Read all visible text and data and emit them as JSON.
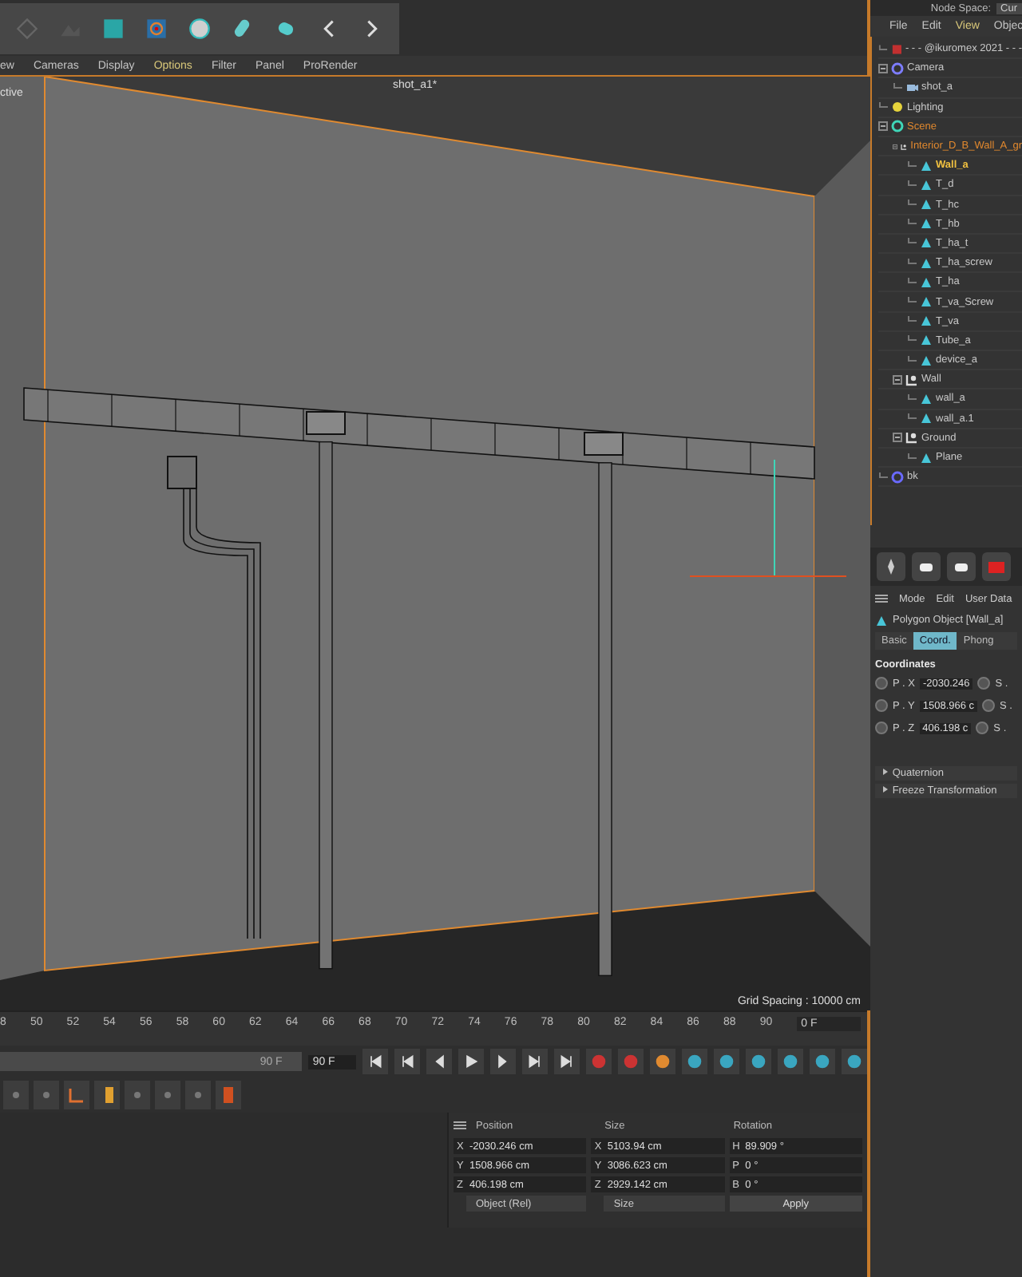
{
  "toolbar_menu": [
    {
      "label": "ew",
      "selected": false
    },
    {
      "label": "Cameras",
      "selected": false
    },
    {
      "label": "Display",
      "selected": false
    },
    {
      "label": "Options",
      "selected": true
    },
    {
      "label": "Filter",
      "selected": false
    },
    {
      "label": "Panel",
      "selected": false
    },
    {
      "label": "ProRender",
      "selected": false
    }
  ],
  "viewport": {
    "camera": "ctive",
    "title": "shot_a1*",
    "grid_spacing": "Grid Spacing : 10000 cm"
  },
  "timeline": {
    "ticks": [
      "8",
      "50",
      "52",
      "54",
      "56",
      "58",
      "60",
      "62",
      "64",
      "66",
      "68",
      "70",
      "72",
      "74",
      "76",
      "78",
      "80",
      "82",
      "84",
      "86",
      "88",
      "90"
    ],
    "current_frame": "0 F",
    "range_end": "90 F",
    "level": 1,
    "max_frame": "90 F"
  },
  "coordinate_manager": {
    "columns": [
      "Position",
      "Size",
      "Rotation"
    ],
    "rows": [
      {
        "axis": "X",
        "position": "-2030.246 cm",
        "size_axis": "X",
        "size": "5103.94 cm",
        "rotation_axis": "H",
        "rotation": "89.909 °"
      },
      {
        "axis": "Y",
        "position": "1508.966 cm",
        "size_axis": "Y",
        "size": "3086.623 cm",
        "rotation_axis": "P",
        "rotation": "0 °"
      },
      {
        "axis": "Z",
        "position": "406.198 cm",
        "size_axis": "Z",
        "size": "2929.142 cm",
        "rotation_axis": "B",
        "rotation": "0 °"
      }
    ],
    "position_mode": "Object (Rel)",
    "size_mode": "Size",
    "apply": "Apply"
  },
  "node_space": {
    "label": "Node Space:",
    "value": "Cur"
  },
  "object_manager": {
    "menu": [
      {
        "label": "File",
        "selected": false
      },
      {
        "label": "Edit",
        "selected": false
      },
      {
        "label": "View",
        "selected": true
      },
      {
        "label": "Objec",
        "selected": false
      }
    ],
    "tree": [
      {
        "label": "- - - @ikuromex 2021 - - -",
        "kind": "marker",
        "selected": false,
        "highlighted": false
      },
      {
        "label": "Camera",
        "kind": "null",
        "selected": false,
        "highlighted": false,
        "children": [
          {
            "label": "shot_a",
            "kind": "camera",
            "selected": false,
            "highlighted": false
          }
        ]
      },
      {
        "label": "Lighting",
        "kind": "light",
        "selected": false,
        "highlighted": false
      },
      {
        "label": "Scene",
        "kind": "scene",
        "selected": false,
        "highlighted": true,
        "children": [
          {
            "label": "Interior_D_B_Wall_A_gr",
            "kind": "group",
            "selected": false,
            "highlighted": true,
            "children": [
              {
                "label": "Wall_a",
                "kind": "polygon",
                "selected": true,
                "highlighted": false
              },
              {
                "label": "T_d",
                "kind": "polygon",
                "selected": false,
                "highlighted": false
              },
              {
                "label": "T_hc",
                "kind": "polygon",
                "selected": false,
                "highlighted": false
              },
              {
                "label": "T_hb",
                "kind": "polygon",
                "selected": false,
                "highlighted": false
              },
              {
                "label": "T_ha_t",
                "kind": "polygon",
                "selected": false,
                "highlighted": false
              },
              {
                "label": "T_ha_screw",
                "kind": "polygon",
                "selected": false,
                "highlighted": false
              },
              {
                "label": "T_ha",
                "kind": "polygon",
                "selected": false,
                "highlighted": false
              },
              {
                "label": "T_va_Screw",
                "kind": "polygon",
                "selected": false,
                "highlighted": false
              },
              {
                "label": "T_va",
                "kind": "polygon",
                "selected": false,
                "highlighted": false
              },
              {
                "label": "Tube_a",
                "kind": "polygon",
                "selected": false,
                "highlighted": false
              },
              {
                "label": "device_a",
                "kind": "polygon",
                "selected": false,
                "highlighted": false
              }
            ]
          },
          {
            "label": "Wall",
            "kind": "group",
            "selected": false,
            "highlighted": false,
            "children": [
              {
                "label": "wall_a",
                "kind": "polygon",
                "selected": false,
                "highlighted": false
              },
              {
                "label": "wall_a.1",
                "kind": "polygon",
                "selected": false,
                "highlighted": false
              }
            ]
          },
          {
            "label": "Ground",
            "kind": "group",
            "selected": false,
            "highlighted": false,
            "children": [
              {
                "label": "Plane",
                "kind": "polygon",
                "selected": false,
                "highlighted": false
              }
            ]
          }
        ]
      },
      {
        "label": "bk",
        "kind": "sky",
        "selected": false,
        "highlighted": false
      }
    ]
  },
  "attributes": {
    "menu": [
      "Mode",
      "Edit",
      "User Data"
    ],
    "title": "Polygon Object [Wall_a]",
    "tabs": [
      {
        "label": "Basic",
        "selected": false
      },
      {
        "label": "Coord.",
        "selected": true
      },
      {
        "label": "Phong",
        "selected": false
      }
    ],
    "section": "Coordinates",
    "fields": [
      {
        "label": "P . X",
        "value": "-2030.246",
        "scale_label": "S ."
      },
      {
        "label": "P . Y",
        "value": "1508.966 c",
        "scale_label": "S ."
      },
      {
        "label": "P . Z",
        "value": "406.198 c",
        "scale_label": "S ."
      }
    ],
    "groups": [
      "Quaternion",
      "Freeze Transformation"
    ]
  }
}
